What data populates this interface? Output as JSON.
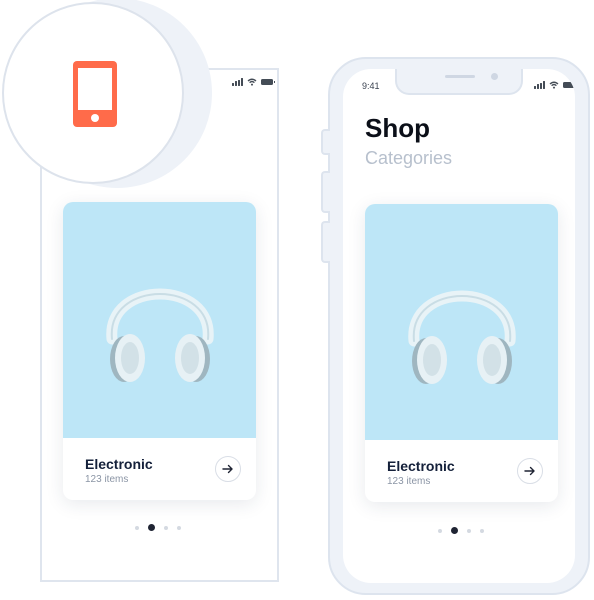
{
  "status": {
    "time": "9:41"
  },
  "callout": {
    "icon": "smartphone-icon",
    "accent": "#ff6b4a"
  },
  "shop": {
    "title": "Shop",
    "subtitle": "Categories"
  },
  "card": {
    "title": "Electronic",
    "count": "123 items",
    "image": "headphones-image",
    "image_bg": "#bde6f7"
  },
  "pager": {
    "total": 4,
    "active": 2
  }
}
